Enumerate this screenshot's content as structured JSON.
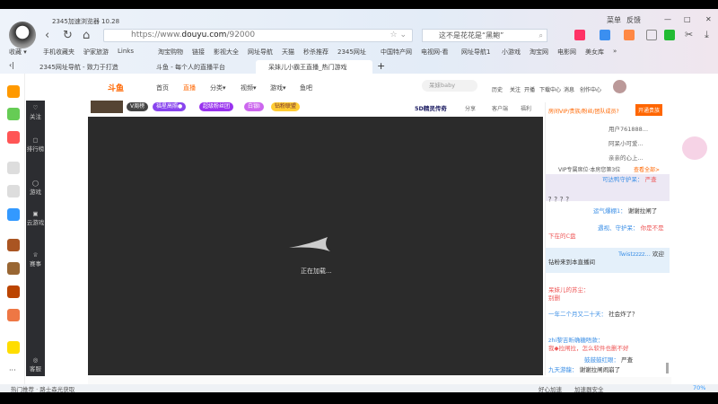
{
  "browser": {
    "title": "2345加速浏览器 10.28",
    "url_prefix": "https://www.",
    "url_domain": "douyu.com",
    "url_path": "/92000",
    "search_text": "这不是花花是“黑鲍”",
    "window_controls": [
      "菜单",
      "反馈",
      "—",
      "□",
      "✕"
    ]
  },
  "bookmarks": [
    "收藏 ▾",
    "手机收藏夹",
    "驴家旅游",
    "Links",
    "淘宝购物",
    "链接",
    "影视大全",
    "网址导航",
    "天猫",
    "秒杀推荐",
    "2345网址",
    "中国特产网",
    "电视网-看",
    "网址导航1",
    "小游戏",
    "淘宝网",
    "电影网",
    "美女库",
    "»"
  ],
  "tabs": [
    {
      "label": "2345网址导航 - 致力于打造"
    },
    {
      "label": "斗鱼 - 每个人的直播平台"
    },
    {
      "label": "呆妹儿小霸王直播_热门游戏",
      "active": true
    }
  ],
  "site": {
    "logo": "斗鱼",
    "nav": [
      "首页",
      "直播",
      "分类▾",
      "视频▾",
      "游戏▾",
      "鱼吧"
    ],
    "search_placeholder": "呆妹baby",
    "icons": [
      "历史",
      "关注",
      "开播",
      "下载中心",
      "消息",
      "创作中心"
    ]
  },
  "sidebar": [
    "关注",
    "排行榜",
    "游戏",
    "云游戏",
    "赛事",
    "客服"
  ],
  "chips": [
    "V周榜",
    "福星高照●",
    "超级粉丝团",
    "白银Ⅰ",
    "钻粉联盟"
  ],
  "toolbar": {
    "brand": "5D精灵传奇",
    "share": "分享",
    "client": "客户端",
    "welfare": "福利"
  },
  "player": {
    "loading": "正在加载..."
  },
  "chat": {
    "vip_banner": "房间VIP/贵族/粉丝/团队成员?",
    "open_noble": "开通贵族",
    "vip_users": [
      "用户761888...",
      "阿呆小可爱...",
      "亲亲的心上..."
    ],
    "vip_seats": "VIP专属席位·本房您第3位",
    "see_all": "查看全部>",
    "messages": [
      {
        "user": "可达鸭守护呆：",
        "text": "严查"
      },
      {
        "user": "",
        "text": "？？？？"
      },
      {
        "user": "运气爆棚1：",
        "text": "谢谢拉闸了"
      },
      {
        "user": "遇视、守护呆：",
        "text": "你是不是下在的C盘"
      },
      {
        "user": "Twistzzzz...",
        "text": "欢迎钻粉来到本直播间"
      },
      {
        "user": "呆妹儿的苏尘：",
        "text": "别删"
      },
      {
        "user": "一年二个月又二十天：",
        "text": "社会炸了？"
      },
      {
        "user": "zhi黎吉昕确糖唔款：",
        "text": "我◆拉闸拉，怎么软件也删不好"
      },
      {
        "user": "鼓鼓鼓红眼：",
        "text": "严查"
      },
      {
        "user": "九天游龍：",
        "text": "谢谢拉闸闹崩了"
      }
    ]
  },
  "status": {
    "left": "热门推荐 · 路士森光获取",
    "items": [
      "好心加速",
      "加速器安全",
      "70%"
    ]
  }
}
